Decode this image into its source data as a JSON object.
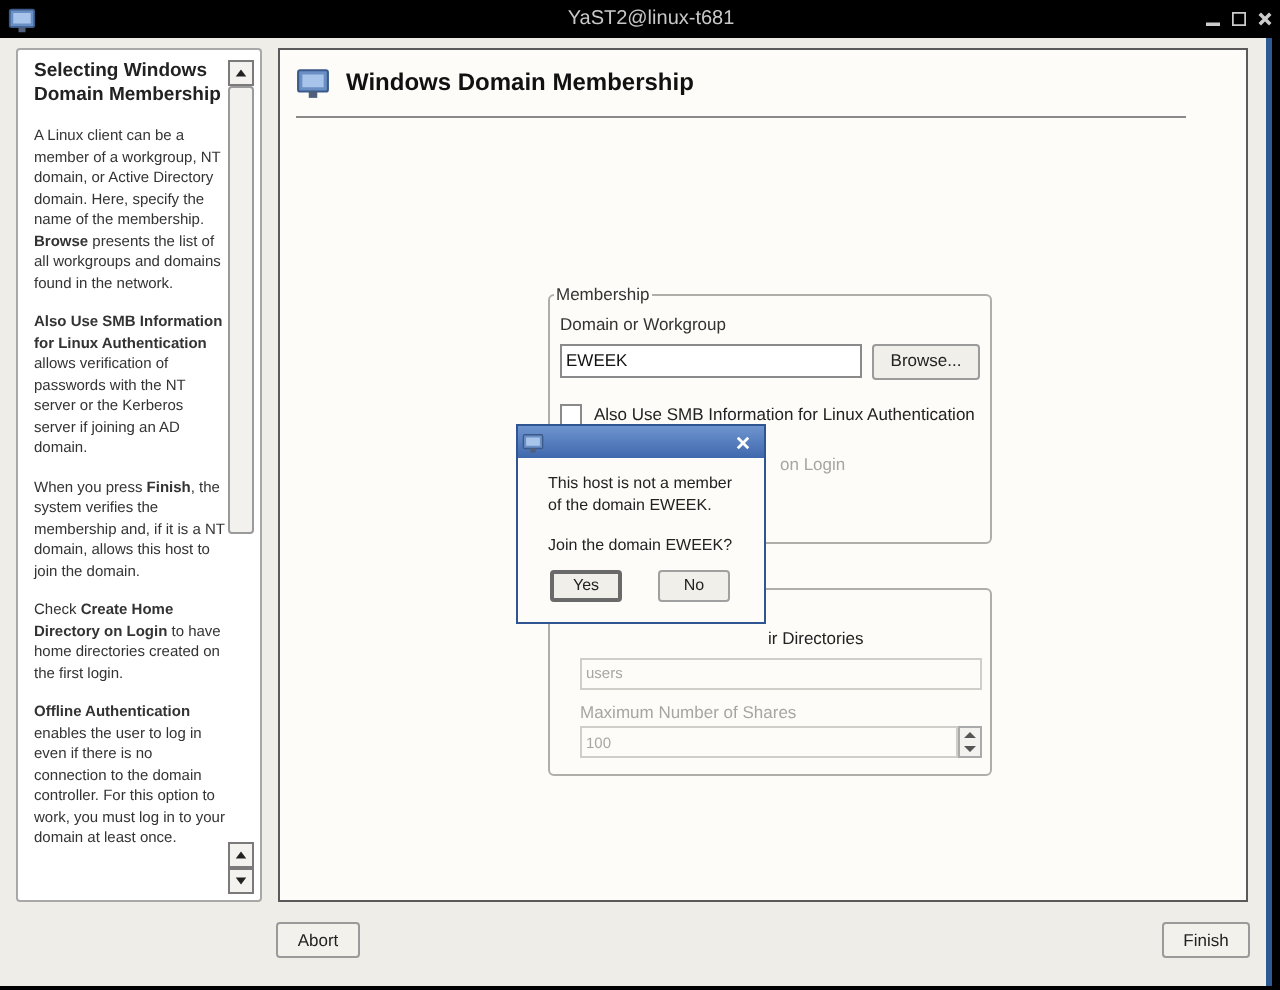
{
  "window": {
    "title": "YaST2@linux-t681"
  },
  "help": {
    "heading": "Selecting Windows Domain Membership",
    "paragraphs": [
      "A Linux client can be a member of a workgroup, NT domain, or Active Directory domain. Here, specify the name of the membership. **Browse** presents the list of all workgroups and domains found in the network.",
      "**Also Use SMB Information for Linux Authentication** allows verification of passwords with the NT server or the Kerberos server if joining an AD domain.",
      "When you press **Finish**, the system verifies the membership and, if it is a NT domain, allows this host to join the domain.",
      "Check **Create Home Directory on Login** to have home directories created on the first login.",
      "**Offline Authentication** enables the user to log in even if there is no connection to the domain controller. For this option to work, you must log in to your domain at least once."
    ]
  },
  "main": {
    "title": "Windows Domain Membership",
    "membership": {
      "legend": "Membership",
      "domain_label": "Domain or Workgroup",
      "domain_value": "EWEEK",
      "browse": "Browse...",
      "smb_label": "Also Use SMB Information for Linux Authentication",
      "smb_checked": false,
      "partial_label": "on Login"
    },
    "shares": {
      "partial_label": "ir Directories",
      "name_value": "users",
      "max_label": "Maximum Number of Shares",
      "max_value": "100",
      "disabled": true
    }
  },
  "dialog": {
    "message": "This host is not a member of the domain EWEEK.",
    "question": "Join the domain EWEEK?",
    "buttons": [
      {
        "label": "Yes",
        "selected": true
      },
      {
        "label": "No",
        "selected": false
      }
    ]
  },
  "buttons": {
    "abort": "Abort",
    "finish": "Finish"
  }
}
